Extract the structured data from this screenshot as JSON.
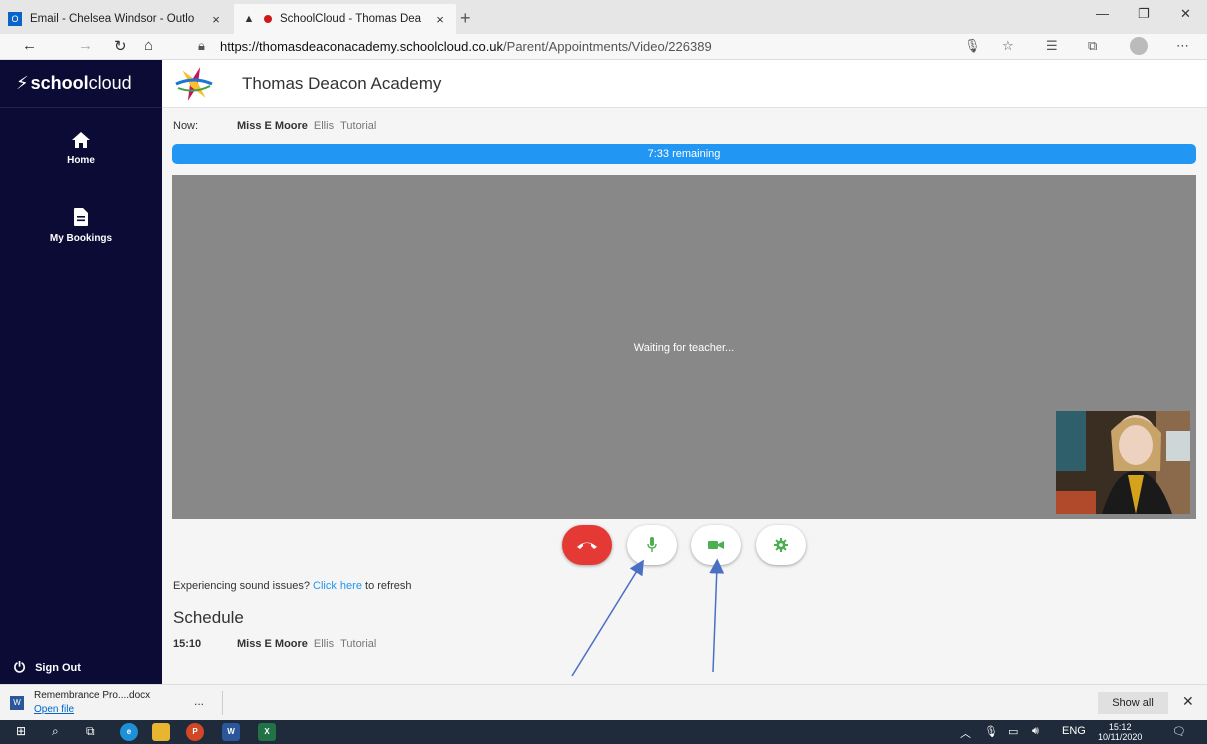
{
  "browser": {
    "tabs": [
      {
        "title": "Email - Chelsea Windsor - Outlo",
        "favicon": "outlook-icon",
        "active": false
      },
      {
        "title": "SchoolCloud - Thomas Dea",
        "favicon": "schoolcloud-icon",
        "active": true
      }
    ],
    "new_tab": "+",
    "url_host": "https://thomasdeaconacademy.schoolcloud.co.uk",
    "url_path": "/Parent/Appointments/Video/226389"
  },
  "sidebar": {
    "brand_bold": "school",
    "brand_light": "cloud",
    "items": [
      {
        "label": "Home",
        "icon": "home-icon"
      },
      {
        "label": "My Bookings",
        "icon": "document-icon"
      }
    ],
    "sign_out": "Sign Out"
  },
  "header": {
    "school_name": "Thomas Deacon Academy"
  },
  "appointment": {
    "now_label": "Now:",
    "teacher": "Miss E Moore",
    "student": "Ellis",
    "type": "Tutorial",
    "remaining": "7:33 remaining",
    "waiting": "Waiting for teacher..."
  },
  "sound": {
    "prefix": "Experiencing sound issues?",
    "link": "Click here",
    "suffix": "to refresh"
  },
  "schedule": {
    "title": "Schedule",
    "rows": [
      {
        "time": "15:10",
        "teacher": "Miss E Moore",
        "student": "Ellis",
        "type": "Tutorial"
      }
    ]
  },
  "download": {
    "file_name": "Remembrance Pro....docx",
    "open_file": "Open file",
    "more": "...",
    "show_all": "Show all"
  },
  "taskbar": {
    "lang": "ENG",
    "time": "15:12",
    "date": "10/11/2020"
  },
  "colors": {
    "sidebar": "#0b0b36",
    "accent": "#2196f3",
    "hangup": "#e53935",
    "control_icon": "#4caf50",
    "video_bg": "#888888",
    "annotation_arrow": "#4a6fc4"
  }
}
